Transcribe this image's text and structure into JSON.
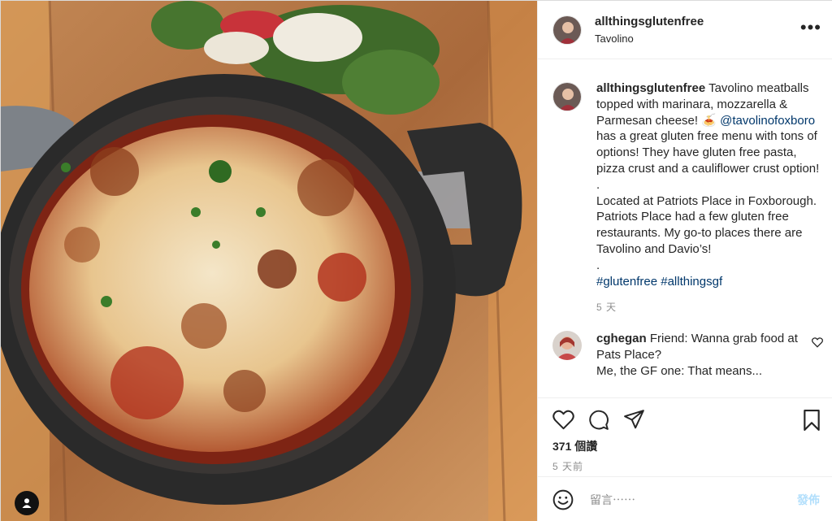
{
  "post": {
    "username": "allthingsglutenfree",
    "location": "Tavolino",
    "more_label": "•••"
  },
  "caption": {
    "username": "allthingsglutenfree",
    "text_1": " Tavolino meatballs topped with marinara, mozzarella & Parmesan cheese! ",
    "emoji": "🍝",
    "mention": "@tavolinofoxboro",
    "text_2": " has a great gluten free menu with tons of options! They have gluten free pasta, pizza crust and a cauliflower crust option!",
    "dot_1": ".",
    "text_3": "Located at Patriots Place in Foxborough. Patriots Place had a few gluten free restaurants. My go-to places there are Tavolino and Davio’s!",
    "dot_2": ".",
    "hashtag_1": "#glutenfree",
    "hashtag_2": "#allthingsgf",
    "age": "5 天"
  },
  "comment": {
    "username": "cghegan",
    "text": " Friend: Wanna grab food at Pats Place?",
    "text_cut": "Me, the GF one: That means..."
  },
  "stats": {
    "likes": "371 個讚",
    "date": "5 天前"
  },
  "composer": {
    "placeholder": "留言⋯⋯",
    "post_label": "發佈"
  },
  "icons": {
    "like": "heart-icon",
    "comment": "comment-icon",
    "share": "paper-plane-icon",
    "save": "bookmark-icon",
    "emoji": "smiley-icon"
  },
  "colors": {
    "link": "#00376b",
    "muted": "#8e8e8e",
    "post_disabled": "#b2dffc"
  }
}
